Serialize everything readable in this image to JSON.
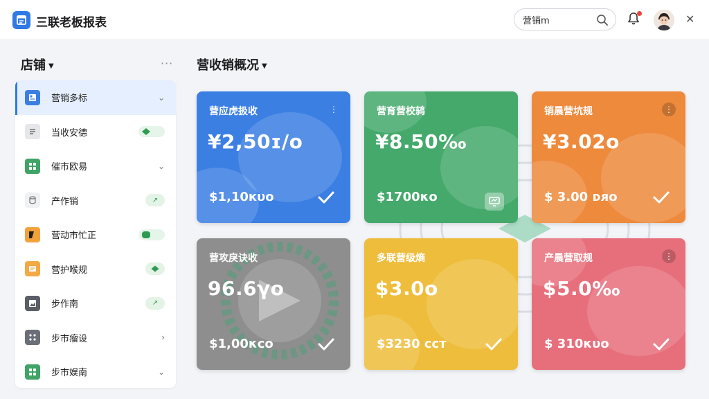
{
  "header": {
    "app_title": "三联老板报表",
    "search_value": "营销m",
    "logo_icon": "report-logo-icon",
    "brand_color": "#2f7ae5"
  },
  "sidebar": {
    "title": "店铺",
    "items": [
      {
        "label": "营销多标",
        "icon": "document-blue-icon",
        "control": "chevron-down"
      },
      {
        "label": "当收安德",
        "icon": "list-gray-icon",
        "control": "toggle"
      },
      {
        "label": "催市欧易",
        "icon": "grid-green-icon",
        "control": "chevron-down"
      },
      {
        "label": "产作销",
        "icon": "cylinder-icon",
        "control": "pill"
      },
      {
        "label": "营动市忙正",
        "icon": "folder-black-orange-icon",
        "control": "toggle"
      },
      {
        "label": "营护喉规",
        "icon": "note-orange-icon",
        "control": "pill"
      },
      {
        "label": "步作南",
        "icon": "image-gray-icon",
        "control": "pill"
      },
      {
        "label": "步市瘤设",
        "icon": "dots-gray-icon",
        "control": "chevron-right"
      },
      {
        "label": "步市娱南",
        "icon": "grid-green-icon",
        "control": "chevron-down"
      }
    ]
  },
  "main": {
    "title": "营收销概况",
    "cards": [
      {
        "title": "营应虎扱收",
        "value": "¥2,50ɪ/o",
        "sub": "$1,10кυo",
        "color": "#3b7fe3"
      },
      {
        "title": "营育营校鸫",
        "value": "¥8.50‰",
        "sub": "$1700κo",
        "color": "#44a96b"
      },
      {
        "title": "销晨营坑规",
        "value": "¥3.02o",
        "sub": "$ 3.00 ᴅᴙo",
        "color": "#ee8a3c"
      },
      {
        "title": "营攻戾诀收",
        "value": "96.6γo",
        "sub": "$1,00κco",
        "color": "#8e8e8e"
      },
      {
        "title": "多联营级熵",
        "value": "$3.0o",
        "sub": "$3230 ᴄᴄт",
        "color": "#eebd3c"
      },
      {
        "title": "产晨营取规",
        "value": "$5.0‰",
        "sub": "$ 310κυo",
        "color": "#e76f7c"
      }
    ]
  }
}
